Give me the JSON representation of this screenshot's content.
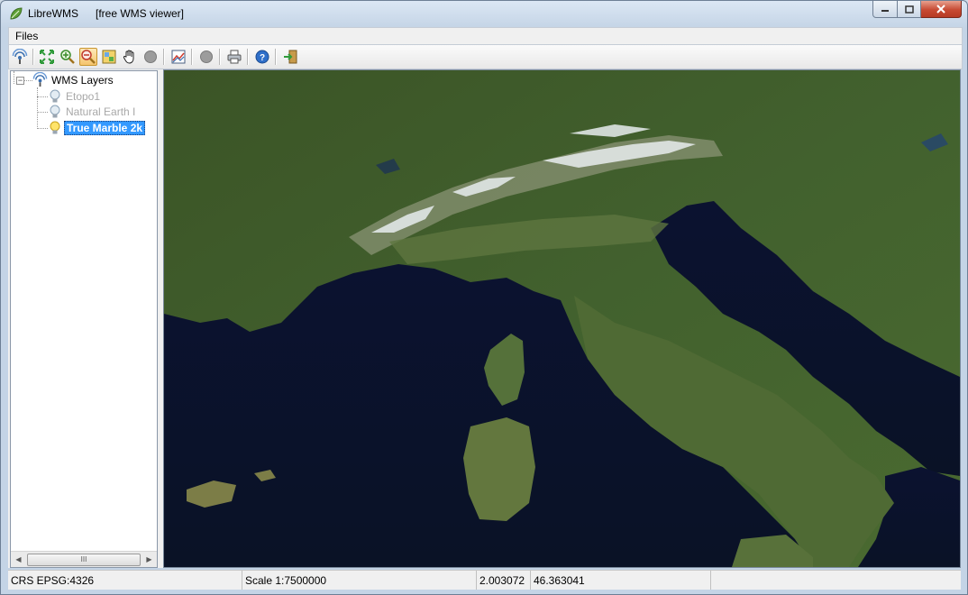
{
  "window": {
    "app_name": "LibreWMS",
    "subtitle": "[free WMS viewer]"
  },
  "menu": {
    "files_label": "Files"
  },
  "toolbar": {
    "buttons": [
      {
        "icon": "wms-connect-icon"
      },
      {
        "icon": "zoom-full-extent-icon"
      },
      {
        "icon": "zoom-in-icon"
      },
      {
        "icon": "zoom-out-icon",
        "active": true
      },
      {
        "icon": "layer-info-icon"
      },
      {
        "icon": "pan-hand-icon"
      },
      {
        "icon": "stop-icon"
      },
      {
        "icon": "refresh-map-icon"
      },
      {
        "icon": "record-icon"
      },
      {
        "icon": "print-icon"
      },
      {
        "icon": "help-icon"
      },
      {
        "icon": "exit-icon"
      }
    ]
  },
  "tree": {
    "root_label": "WMS Layers",
    "layers": [
      {
        "label": "Etopo1",
        "state": "inactive"
      },
      {
        "label": "Natural Earth I",
        "state": "inactive"
      },
      {
        "label": "True Marble 2k",
        "state": "selected"
      }
    ],
    "scroll_thumb": "III"
  },
  "status": {
    "crs": "CRS EPSG:4326",
    "scale": "Scale 1:7500000",
    "lon": "2.003072",
    "lat": "46.363041"
  },
  "colors": {
    "selection": "#3399ff",
    "sea": "#0b1330",
    "land": "#3d5a2a",
    "close_button": "#c74a33"
  }
}
